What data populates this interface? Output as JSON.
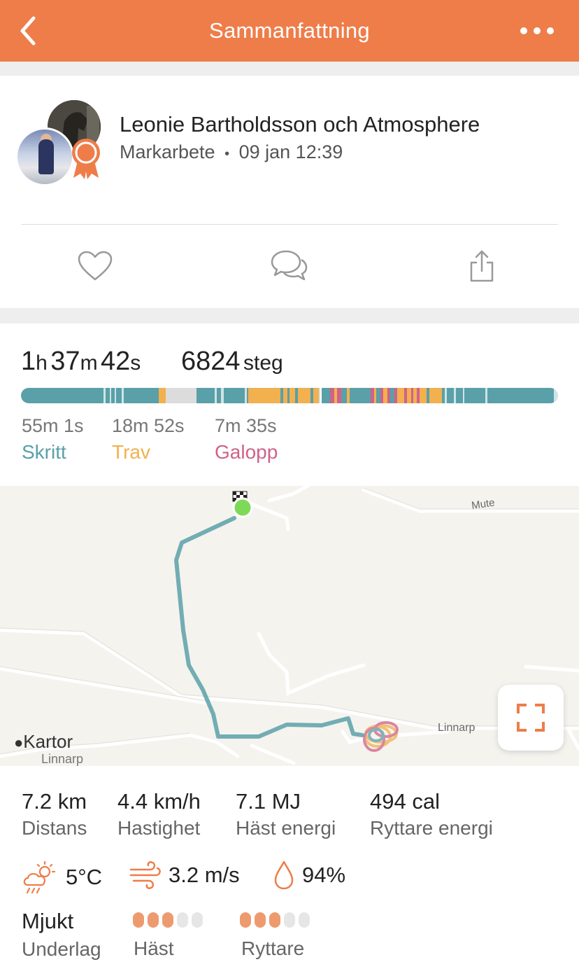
{
  "header": {
    "title": "Sammanfattning"
  },
  "post": {
    "title": "Leonie Bartholdsson och Atmosphere",
    "activity": "Markarbete",
    "separator": "•",
    "datetime": "09 jan 12:39"
  },
  "summary": {
    "duration": {
      "h": "1",
      "h_unit": "h",
      "m": "37",
      "m_unit": "m",
      "s": "42",
      "s_unit": "s"
    },
    "steps": {
      "value": "6824",
      "unit": "steg"
    },
    "gaits": [
      {
        "time": "55m 1s",
        "label": "Skritt",
        "color": "#5aa0a8"
      },
      {
        "time": "18m 52s",
        "label": "Trav",
        "color": "#f2b04f"
      },
      {
        "time": "7m 35s",
        "label": "Galopp",
        "color": "#d0628a"
      }
    ]
  },
  "map": {
    "attribution": "Kartor",
    "road_labels": [
      "Mute",
      "Linnarp",
      "Linnarp"
    ]
  },
  "metrics": [
    {
      "value": "7.2 km",
      "label": "Distans"
    },
    {
      "value": "4.4 km/h",
      "label": "Hastighet"
    },
    {
      "value": "7.1 MJ",
      "label": "Häst energi"
    },
    {
      "value": "494 cal",
      "label": "Ryttare energi"
    }
  ],
  "weather": {
    "temperature": "5°C",
    "wind": "3.2 m/s",
    "humidity": "94%"
  },
  "conditions": {
    "surface_value": "Mjukt",
    "surface_label": "Underlag",
    "horse_label": "Häst",
    "horse_rating": 3,
    "rider_label": "Ryttare",
    "rider_rating": 3,
    "rating_max": 5
  },
  "colors": {
    "accent": "#ee7d4a",
    "walk": "#5aa0a8",
    "trot": "#f2b04f",
    "canter": "#d0628a"
  }
}
